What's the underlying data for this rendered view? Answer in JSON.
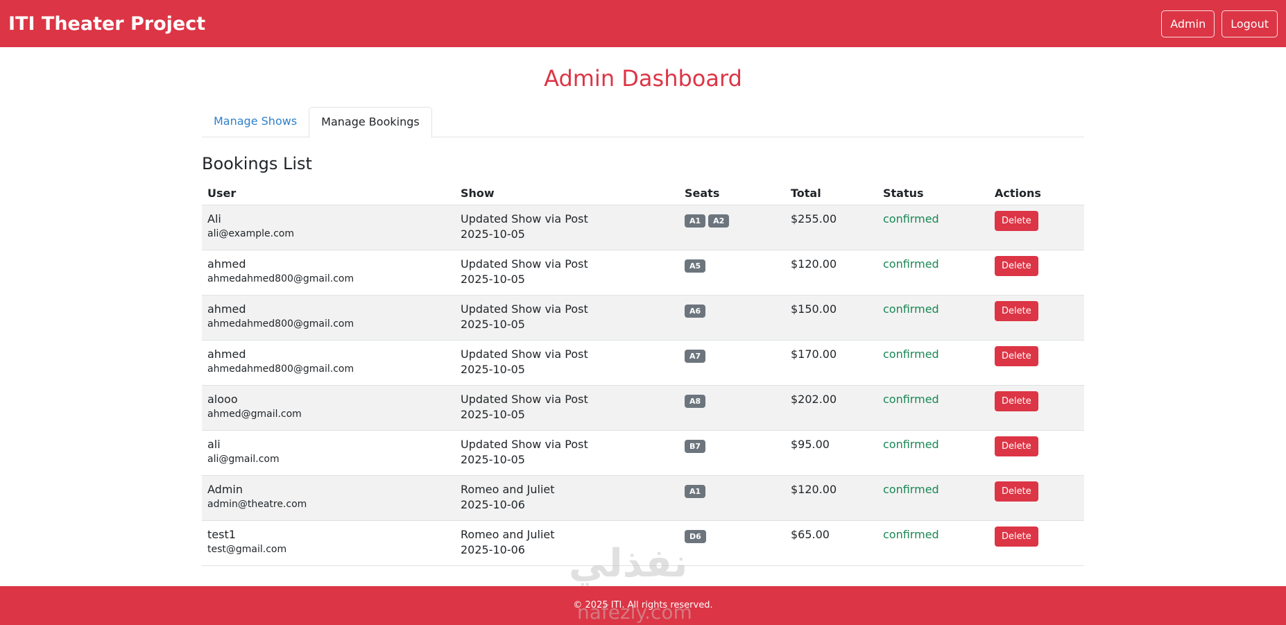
{
  "navbar": {
    "brand": "ITI Theater Project",
    "admin_label": "Admin",
    "logout_label": "Logout"
  },
  "page": {
    "title": "Admin Dashboard",
    "tabs": [
      {
        "label": "Manage Shows",
        "active": false
      },
      {
        "label": "Manage Bookings",
        "active": true
      }
    ],
    "section_title": "Bookings List"
  },
  "table": {
    "headers": [
      "User",
      "Show",
      "Seats",
      "Total",
      "Status",
      "Actions"
    ],
    "rows": [
      {
        "name": "Ali",
        "email": "ali@example.com",
        "show": "Updated Show via Post",
        "date": "2025-10-05",
        "seats": [
          "A1",
          "A2"
        ],
        "total": "$255.00",
        "status": "confirmed",
        "action": "Delete"
      },
      {
        "name": "ahmed",
        "email": "ahmedahmed800@gmail.com",
        "show": "Updated Show via Post",
        "date": "2025-10-05",
        "seats": [
          "A5"
        ],
        "total": "$120.00",
        "status": "confirmed",
        "action": "Delete"
      },
      {
        "name": "ahmed",
        "email": "ahmedahmed800@gmail.com",
        "show": "Updated Show via Post",
        "date": "2025-10-05",
        "seats": [
          "A6"
        ],
        "total": "$150.00",
        "status": "confirmed",
        "action": "Delete"
      },
      {
        "name": "ahmed",
        "email": "ahmedahmed800@gmail.com",
        "show": "Updated Show via Post",
        "date": "2025-10-05",
        "seats": [
          "A7"
        ],
        "total": "$170.00",
        "status": "confirmed",
        "action": "Delete"
      },
      {
        "name": "alooo",
        "email": "ahmed@gmail.com",
        "show": "Updated Show via Post",
        "date": "2025-10-05",
        "seats": [
          "A8"
        ],
        "total": "$202.00",
        "status": "confirmed",
        "action": "Delete"
      },
      {
        "name": "ali",
        "email": "ali@gmail.com",
        "show": "Updated Show via Post",
        "date": "2025-10-05",
        "seats": [
          "B7"
        ],
        "total": "$95.00",
        "status": "confirmed",
        "action": "Delete"
      },
      {
        "name": "Admin",
        "email": "admin@theatre.com",
        "show": "Romeo and Juliet",
        "date": "2025-10-06",
        "seats": [
          "A1"
        ],
        "total": "$120.00",
        "status": "confirmed",
        "action": "Delete"
      },
      {
        "name": "test1",
        "email": "test@gmail.com",
        "show": "Romeo and Juliet",
        "date": "2025-10-06",
        "seats": [
          "D6"
        ],
        "total": "$65.00",
        "status": "confirmed",
        "action": "Delete"
      }
    ]
  },
  "footer": {
    "text": "© 2025 ITI. All rights reserved."
  },
  "watermark": {
    "main": "نفذلي",
    "sub": "nafezly.com"
  },
  "colors": {
    "brand_red": "#dc3545",
    "badge_gray": "#6c757d",
    "status_green": "#198754",
    "link_blue": "#2f80c9"
  }
}
